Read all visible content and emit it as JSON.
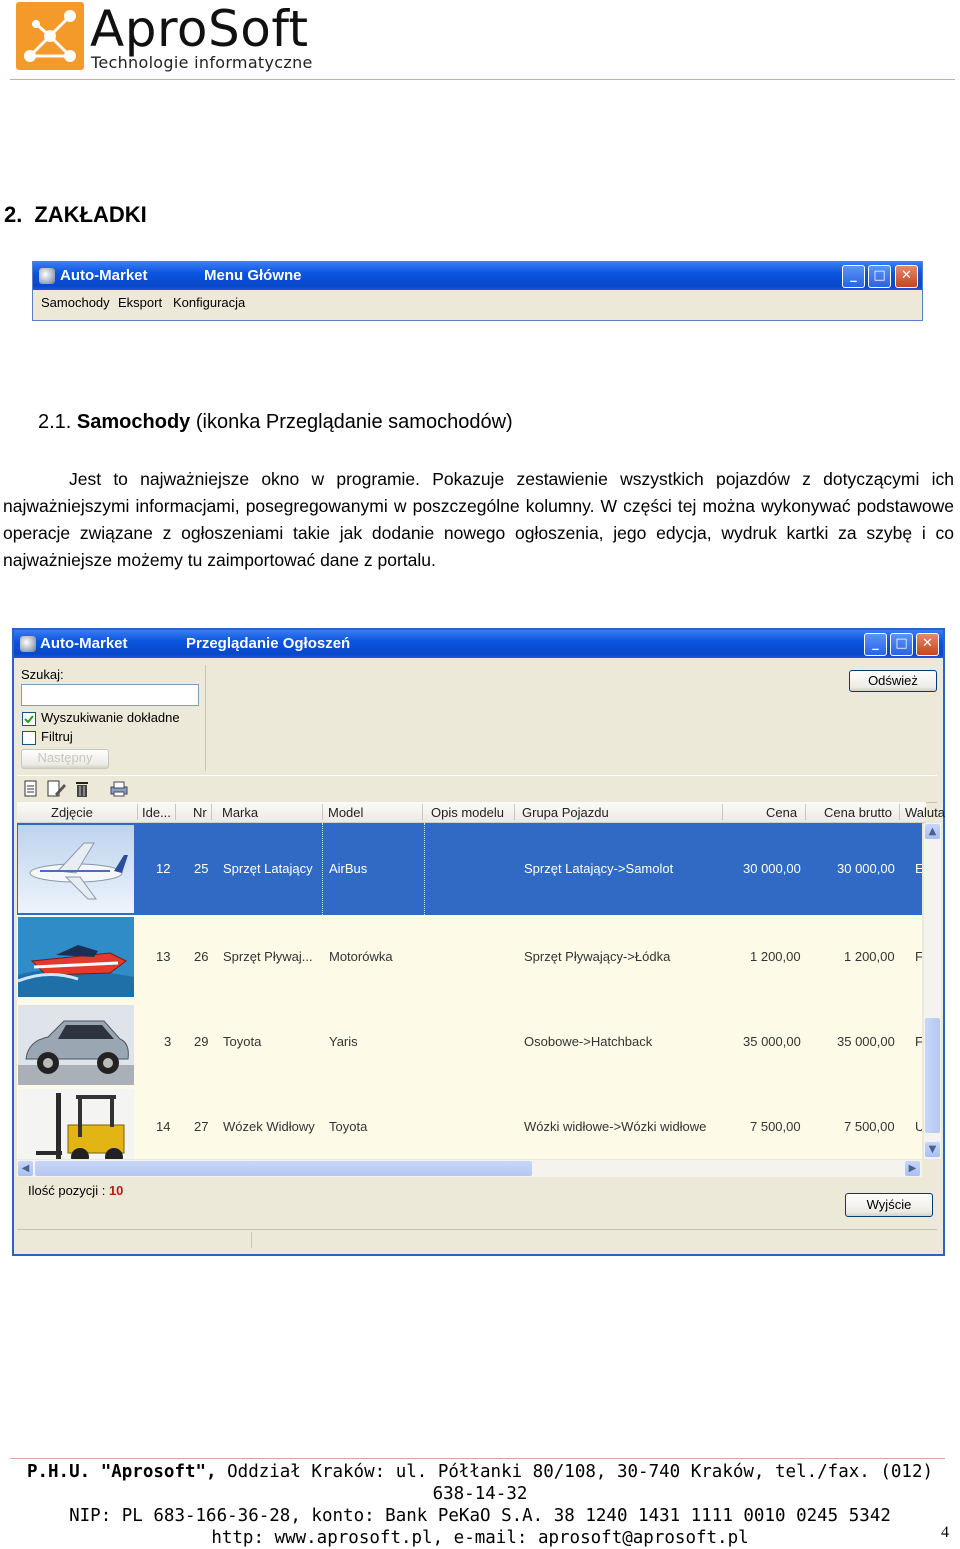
{
  "brand": {
    "name": "AproSoft",
    "tagline": "Technologie informatyczne",
    "accent_color": "#f39a2b"
  },
  "section": {
    "number": "2.",
    "title": "ZAKŁADKI"
  },
  "main_menu_window": {
    "app_title": "Auto-Market",
    "window_title": "Menu Główne",
    "menu": [
      "Samochody",
      "Eksport",
      "Konfiguracja"
    ]
  },
  "subsection": {
    "number": "2.1.",
    "bold_title": "Samochody",
    "rest": "(ikonka Przeglądanie samochodów)"
  },
  "paragraph": "Jest to najważniejsze okno w programie. Pokazuje zestawienie wszystkich pojazdów z dotyczącymi ich najważniejszymi informacjami, posegregowanymi w poszczególne kolumny. W części tej można wykonywać podstawowe operacje związane z ogłoszeniami takie jak dodanie nowego ogłoszenia, jego edycja, wydruk kartki za szybę i co najważniejsze możemy tu zaimportować dane z portalu.",
  "browse_window": {
    "app_title": "Auto-Market",
    "window_title": "Przeglądanie Ogłoszeń",
    "search_label": "Szukaj:",
    "search_value": "",
    "exact_search_label": "Wyszukiwanie dokładne",
    "exact_search_checked": true,
    "filter_label": "Filtruj",
    "filter_checked": false,
    "next_button": "Następny",
    "refresh_button": "Odśwież",
    "columns": [
      "Zdjęcie",
      "Ide...",
      "Nr",
      "Marka",
      "Model",
      "Opis modelu",
      "Grupa Pojazdu",
      "Cena",
      "Cena brutto",
      "Waluta"
    ],
    "rows": [
      {
        "photo": "airplane-photo",
        "id": "12",
        "nr": "25",
        "marka": "Sprzęt Latający",
        "model": "AirBus",
        "opis": "",
        "grupa": "Sprzęt Latający->Samolot",
        "cena": "30 000,00",
        "brutto": "30 000,00",
        "waluta": "E"
      },
      {
        "photo": "motorboat-photo",
        "id": "13",
        "nr": "26",
        "marka": "Sprzęt Pływaj...",
        "model": "Motorówka",
        "opis": "",
        "grupa": "Sprzęt Pływający->Łódka",
        "cena": "1 200,00",
        "brutto": "1 200,00",
        "waluta": "F"
      },
      {
        "photo": "car-photo",
        "id": "3",
        "nr": "29",
        "marka": "Toyota",
        "model": "Yaris",
        "opis": "",
        "grupa": "Osobowe->Hatchback",
        "cena": "35 000,00",
        "brutto": "35 000,00",
        "waluta": "F"
      },
      {
        "photo": "forklift-photo",
        "id": "14",
        "nr": "27",
        "marka": "Wózek Widłowy",
        "model": "Toyota",
        "opis": "",
        "grupa": "Wózki widłowe->Wózki widłowe",
        "cena": "7 500,00",
        "brutto": "7 500,00",
        "waluta": "U"
      }
    ],
    "count_label": "Ilość pozycji :",
    "count_value": "10",
    "exit_button": "Wyjście",
    "selected_row_color": "#316ac5"
  },
  "footer": {
    "line1_bold": "P.H.U. \"Aprosoft\",",
    "line1_rest": " Oddział Kraków: ul. Półłanki 80/108, 30-740 Kraków, tel./fax. (012) 638-14-32",
    "line2": "NIP: PL 683-166-36-28, konto: Bank PeKaO S.A. 38 1240 1431 1111 0010 0245 5342",
    "line3": "http: www.aprosoft.pl,  e-mail: aprosoft@aprosoft.pl"
  },
  "page_number": "4"
}
